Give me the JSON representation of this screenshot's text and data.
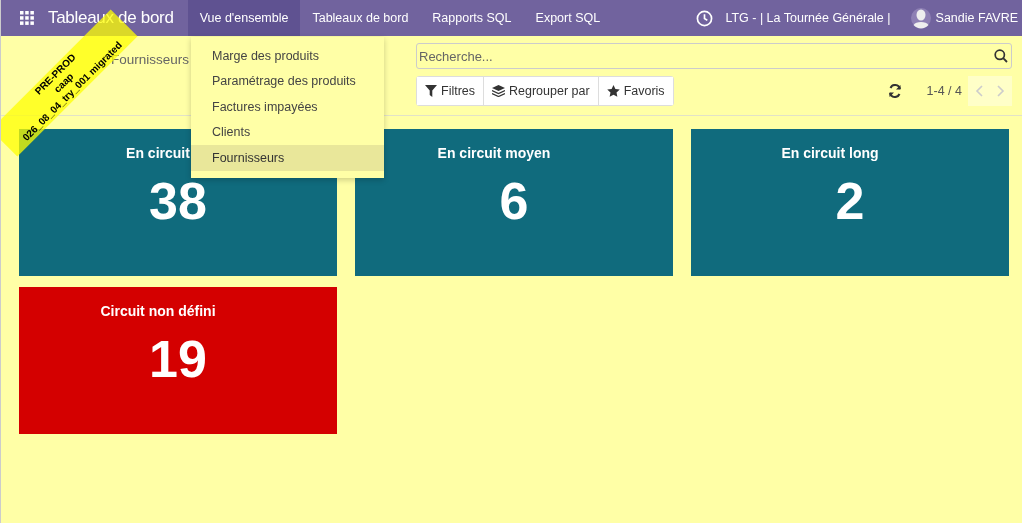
{
  "navbar": {
    "app_title": "Tableaux de bord",
    "menus": [
      {
        "label": "Vue d'ensemble",
        "selected": true
      },
      {
        "label": "Tableaux de bord",
        "selected": false
      },
      {
        "label": "Rapports SQL",
        "selected": false
      },
      {
        "label": "Export SQL",
        "selected": false
      }
    ],
    "company": "LTG - | La Tournée Générale |",
    "user": "Sandie FAVRE"
  },
  "dropdown": {
    "items": [
      {
        "label": "Marge des produits",
        "selected": false
      },
      {
        "label": "Paramétrage des produits",
        "selected": false
      },
      {
        "label": "Factures impayées",
        "selected": false
      },
      {
        "label": "Clients",
        "selected": false
      },
      {
        "label": "Fournisseurs",
        "selected": true
      }
    ]
  },
  "ribbon": {
    "lines": [
      "PRE-PROD",
      "caap",
      "026_08_04_try_001 migrated"
    ]
  },
  "control_panel": {
    "breadcrumb": "Fournisseurs",
    "search": {
      "placeholder": "Recherche..."
    },
    "filters": [
      "Filtres",
      "Regrouper par",
      "Favoris"
    ],
    "pager": "1-4 / 4"
  },
  "cards": [
    {
      "title": "En circuit",
      "value": "38",
      "color": "#106b7d"
    },
    {
      "title": "En circuit moyen",
      "value": "6",
      "color": "#106b7d"
    },
    {
      "title": "En circuit long",
      "value": "2",
      "color": "#106b7d"
    },
    {
      "title": "Circuit non défini",
      "value": "19",
      "color": "#d40000"
    }
  ]
}
